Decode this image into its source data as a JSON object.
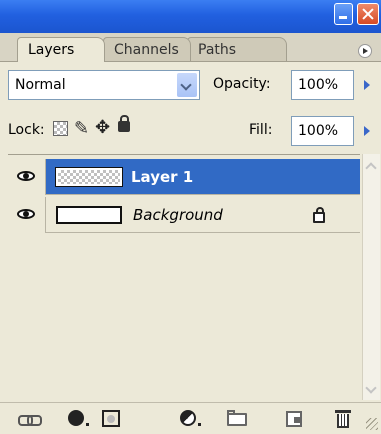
{
  "tabs": [
    {
      "label": "Layers",
      "active": true
    },
    {
      "label": "Channels",
      "active": false
    },
    {
      "label": "Paths",
      "active": false
    }
  ],
  "blend_mode": {
    "selected": "Normal"
  },
  "opacity": {
    "label": "Opacity:",
    "value": "100%"
  },
  "lock": {
    "label": "Lock:"
  },
  "fill": {
    "label": "Fill:",
    "value": "100%"
  },
  "layers": [
    {
      "name": "Layer 1",
      "visible": true,
      "selected": true,
      "locked": false
    },
    {
      "name": "Background",
      "visible": true,
      "selected": false,
      "locked": true
    }
  ],
  "colors": {
    "titlebar": "#2160e0",
    "selection": "#316ac5",
    "panel": "#ece9d8"
  },
  "toolbar_icons": [
    "link-layers-icon",
    "layer-style-icon",
    "layer-mask-icon",
    "adjustment-layer-icon",
    "new-group-icon",
    "new-layer-icon",
    "delete-layer-icon"
  ]
}
